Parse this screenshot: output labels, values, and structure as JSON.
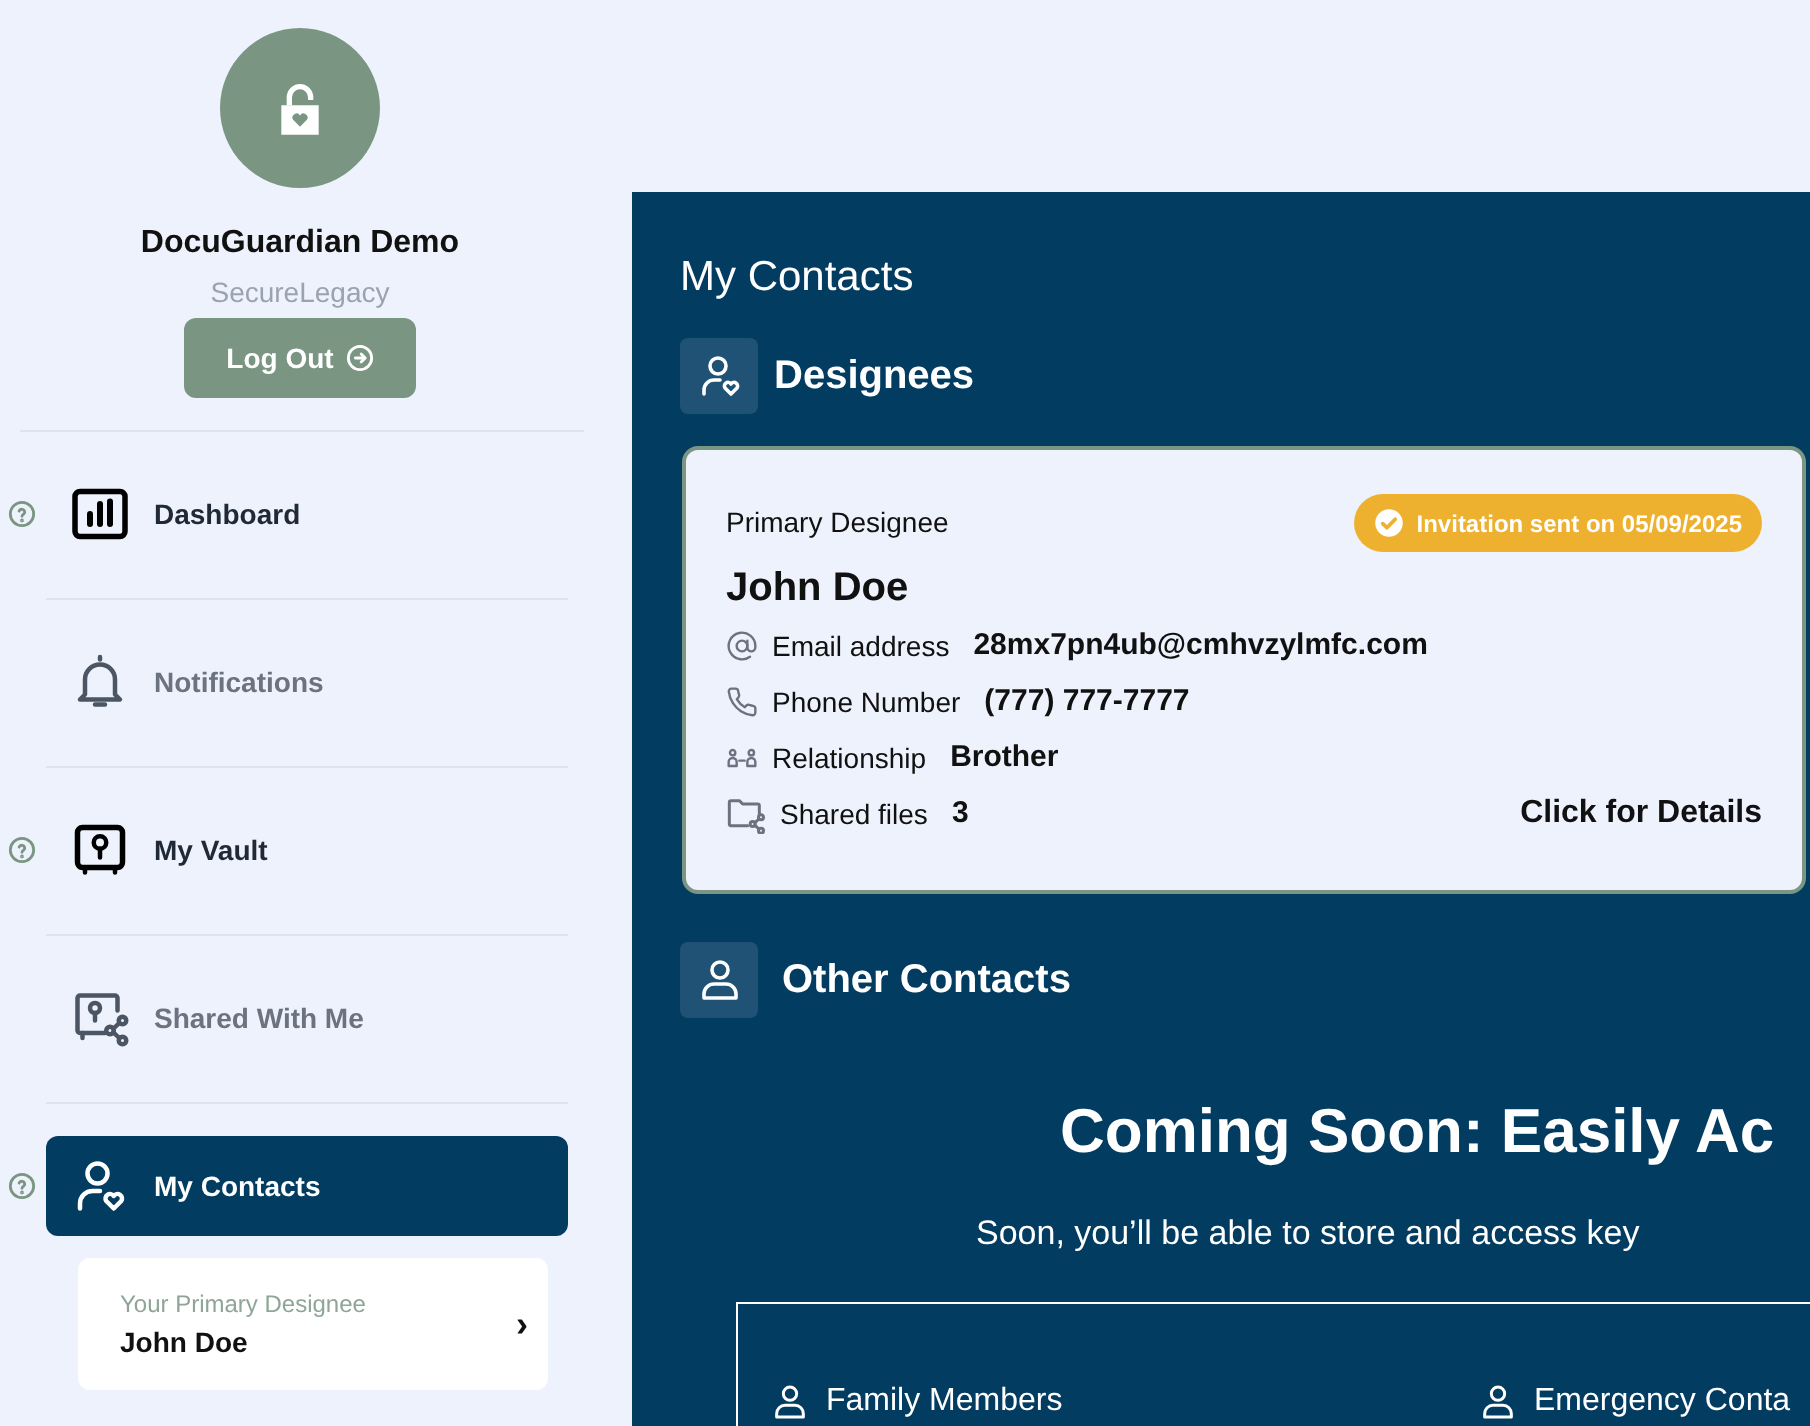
{
  "profile": {
    "name": "DocuGuardian Demo",
    "subtitle": "SecureLegacy",
    "logout": "Log Out"
  },
  "nav": [
    {
      "label": "Dashboard",
      "kind": "chart",
      "help": true,
      "disabled": false,
      "selected": false
    },
    {
      "label": "Notifications",
      "kind": "bell",
      "help": false,
      "disabled": true,
      "selected": false
    },
    {
      "label": "My Vault",
      "kind": "vault",
      "help": true,
      "disabled": false,
      "selected": false
    },
    {
      "label": "Shared With Me",
      "kind": "share",
      "help": false,
      "disabled": true,
      "selected": false
    },
    {
      "label": "My Contacts",
      "kind": "contact",
      "help": true,
      "disabled": false,
      "selected": true
    }
  ],
  "designee_link": {
    "caption": "Your Primary Designee",
    "name": "John Doe",
    "chevron": "›"
  },
  "main": {
    "title": "My Contacts",
    "designees": {
      "heading": "Designees",
      "card": {
        "caption": "Primary Designee",
        "badge": "Invitation sent on 05/09/2025",
        "name": "John Doe",
        "fields": [
          {
            "kind": "email",
            "label": "Email address",
            "value": "28mx7pn4ub@cmhvzylmfc.com"
          },
          {
            "kind": "phone",
            "label": "Phone Number",
            "value": "(777) 777-7777"
          },
          {
            "kind": "relation",
            "label": "Relationship",
            "value": "Brother"
          },
          {
            "kind": "files",
            "label": "Shared files",
            "value": "3"
          }
        ],
        "details_link": "Click for Details"
      }
    },
    "other": {
      "heading": "Other Contacts",
      "coming_title": "Coming Soon: Easily Ac",
      "coming_text": "Soon, you’ll be able to store and access key",
      "categories": [
        "Family Members",
        "Emergency Conta"
      ]
    }
  }
}
